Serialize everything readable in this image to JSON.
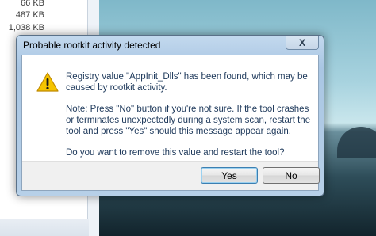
{
  "explorer": {
    "sizes": [
      "66 KB",
      "487 KB",
      "1,038 KB"
    ]
  },
  "dialog": {
    "title": "Probable rootkit activity detected",
    "close_glyph": "X",
    "message": {
      "line1": "Registry value \"AppInit_Dlls\" has been found, which may be caused by rootkit activity.",
      "line2": "Note: Press \"No\" button if you're not sure. If the tool crashes or terminates unexpectedly during a system scan, restart the tool and press \"Yes\" should this message appear again.",
      "line3": "Do you want to remove this value and restart the tool?"
    },
    "buttons": {
      "yes": "Yes",
      "no": "No"
    },
    "icon": "warning-icon"
  },
  "colors": {
    "message_text": "#1e395b",
    "warning_yellow": "#f5c400"
  }
}
